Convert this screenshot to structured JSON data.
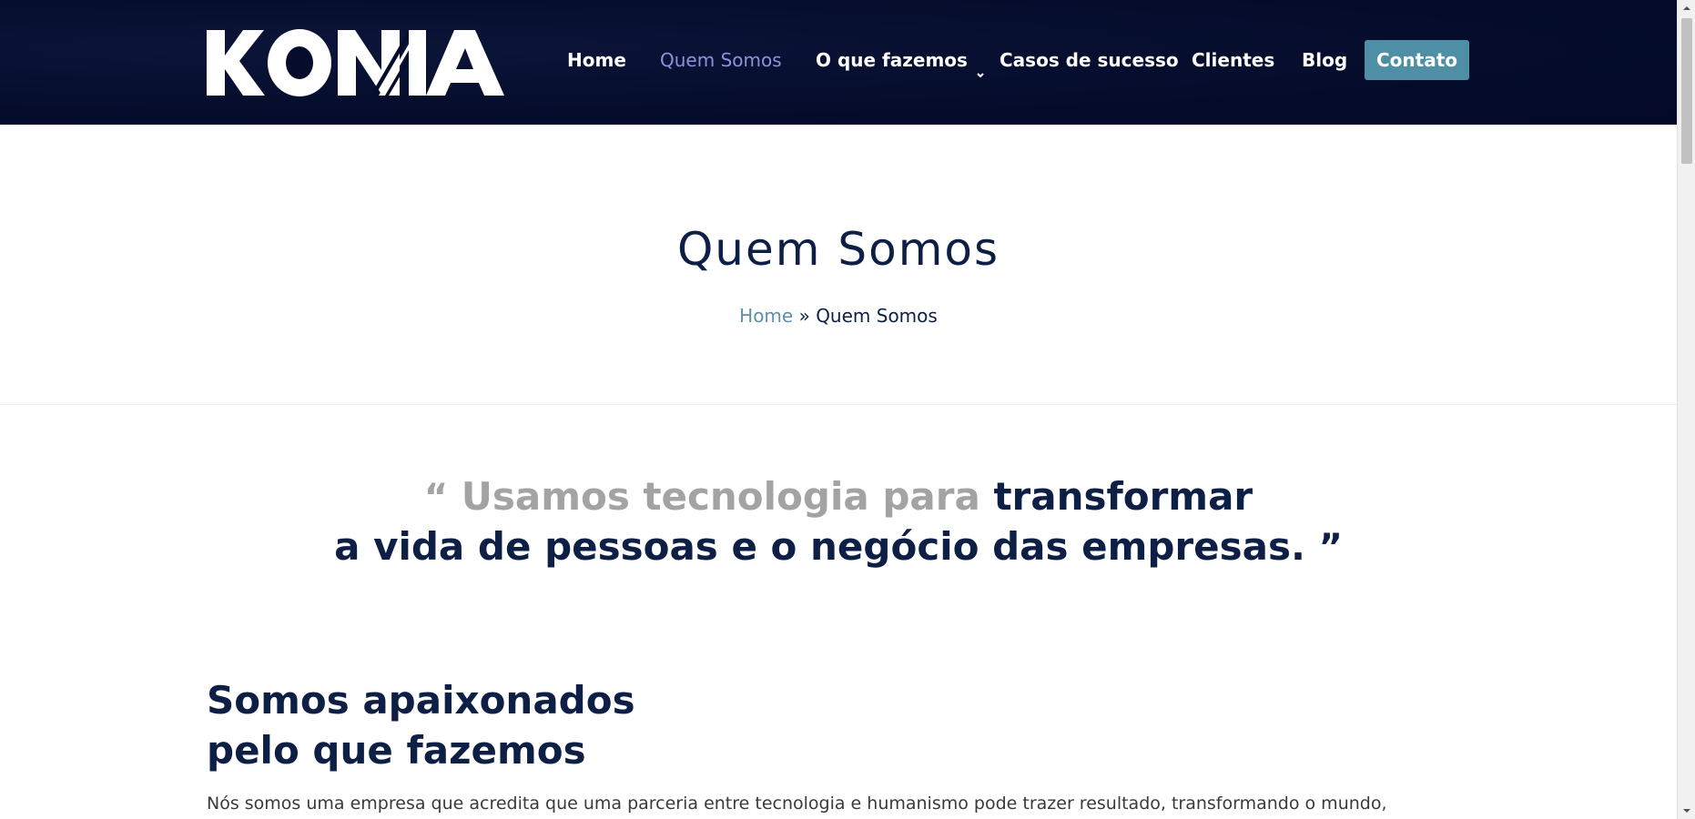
{
  "header": {
    "logo_text": "KONIA",
    "nav": {
      "home": "Home",
      "quem_somos": "Quem Somos",
      "o_que_fazemos": "O que fazemos",
      "casos": "Casos de sucesso",
      "clientes": "Clientes",
      "blog": "Blog",
      "contato": "Contato"
    },
    "active_item": "Quem Somos"
  },
  "title_section": {
    "page_title": "Quem Somos",
    "breadcrumb": {
      "home": "Home",
      "separator": "»",
      "current": "Quem Somos"
    }
  },
  "quote": {
    "open_mark": "“",
    "part1": "Usamos tecnologia para",
    "part2": "transformar",
    "part3": "a vida de pessoas",
    "part4": "e o negócio das empresas.",
    "close_mark": "”"
  },
  "about": {
    "title_line1": "Somos apaixonados",
    "title_line2": "pelo que fazemos",
    "text": "Nós somos uma empresa que acredita que uma parceria entre tecnologia e humanismo pode trazer resultado, transformando o mundo,"
  },
  "colors": {
    "header_bg": "#050c2c",
    "accent": "#4f8fa6",
    "active_nav": "#8d92dc",
    "navy_text": "#0e1f45",
    "grey_text": "#a3a3a3"
  }
}
